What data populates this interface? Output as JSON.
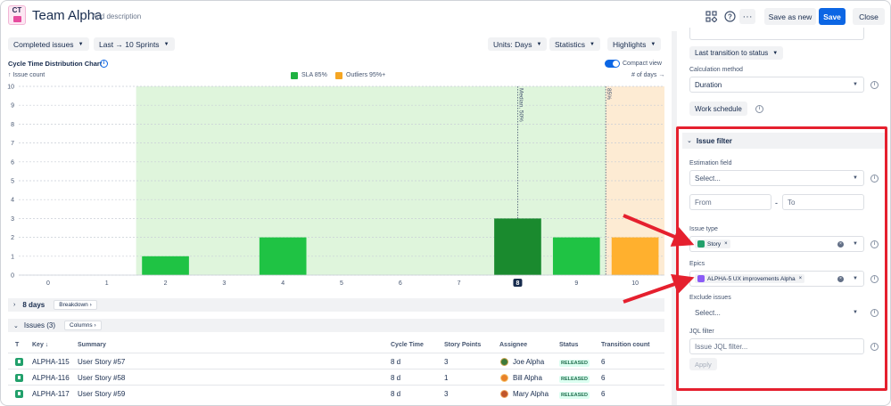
{
  "header": {
    "logo_text": "CT",
    "team_name": "Team Alpha",
    "add_description": "Add description",
    "save_as_new": "Save as new",
    "save": "Save",
    "close": "Close"
  },
  "toolbar": {
    "issues_dropdown": "Completed issues",
    "period_dropdown": "Last → 10 Sprints",
    "units_dropdown": "Units: Days",
    "statistics_dropdown": "Statistics",
    "highlights_dropdown": "Highlights"
  },
  "chart": {
    "title": "Cycle Time Distribution Chart",
    "y_axis_label": "↑ Issue count",
    "x_axis_label": "# of days →",
    "compact_view_label": "Compact view",
    "compact_view_on": true,
    "legend": [
      {
        "label": "SLA 85%",
        "color": "#1fb141"
      },
      {
        "label": "Outliers 95%+",
        "color": "#f5a623"
      }
    ],
    "median_label": "Median, 50%",
    "p85_label": "85%"
  },
  "chart_data": {
    "type": "bar",
    "title": "Cycle Time Distribution Chart",
    "xlabel": "# of days",
    "ylabel": "Issue count",
    "categories": [
      0,
      1,
      2,
      3,
      4,
      5,
      6,
      7,
      8,
      9,
      10
    ],
    "values": [
      0,
      0,
      1,
      0,
      2,
      0,
      0,
      0,
      3,
      2,
      2
    ],
    "bar_colors": [
      "#1fc344",
      "#1fc344",
      "#1fc344",
      "#1fc344",
      "#1fc344",
      "#1fc344",
      "#1fc344",
      "#1fc344",
      "#1a8a2e",
      "#1fc344",
      "#ffb02e"
    ],
    "ylim": [
      0,
      10
    ],
    "yticks": [
      0,
      1,
      2,
      3,
      4,
      5,
      6,
      7,
      8,
      9,
      10
    ],
    "highlighted_x": 8,
    "sla_region": [
      2,
      10
    ],
    "outlier_region_start": 10,
    "median_x": 8,
    "p85_x": 10,
    "grid": true
  },
  "breakdown": {
    "label": "8 days",
    "button": "Breakdown"
  },
  "issues": {
    "label": "Issues (3)",
    "columns_button": "Columns",
    "headers": [
      "T",
      "Key",
      "Summary",
      "Cycle Time",
      "Story Points",
      "Assignee",
      "Status",
      "Transition count"
    ],
    "rows": [
      {
        "key": "ALPHA-115",
        "summary": "User Story #57",
        "cycle_time": "8 d",
        "story_points": "3",
        "assignee": "Joe Alpha",
        "status": "RELEASED",
        "transitions": "6",
        "avatar_color": "#3d7a3a"
      },
      {
        "key": "ALPHA-116",
        "summary": "User Story #58",
        "cycle_time": "8 d",
        "story_points": "1",
        "assignee": "Bill Alpha",
        "status": "RELEASED",
        "transitions": "6",
        "avatar_color": "#e8822a"
      },
      {
        "key": "ALPHA-117",
        "summary": "User Story #59",
        "cycle_time": "8 d",
        "story_points": "3",
        "assignee": "Mary Alpha",
        "status": "RELEASED",
        "transitions": "6",
        "avatar_color": "#c0562b"
      }
    ]
  },
  "panel": {
    "last_transition_btn": "Last transition to status",
    "calc_method_label": "Calculation method",
    "calc_method_value": "Duration",
    "work_schedule_btn": "Work schedule",
    "issue_filter_title": "Issue filter",
    "estimation_label": "Estimation field",
    "estimation_placeholder": "Select...",
    "from_placeholder": "From",
    "range_dash": "-",
    "to_placeholder": "To",
    "issue_type_label": "Issue type",
    "issue_type_chip": "Story",
    "epics_label": "Epics",
    "epics_chip": "ALPHA-5 UX improvements Alpha",
    "exclude_label": "Exclude issues",
    "exclude_placeholder": "Select...",
    "jql_label": "JQL filter",
    "jql_placeholder": "Issue JQL filter...",
    "apply_btn": "Apply"
  },
  "colors": {
    "accent": "#0c66e4",
    "sla_region": "#dff5dc",
    "outlier_region": "#fdebd3",
    "annotation_red": "#e5202e"
  }
}
